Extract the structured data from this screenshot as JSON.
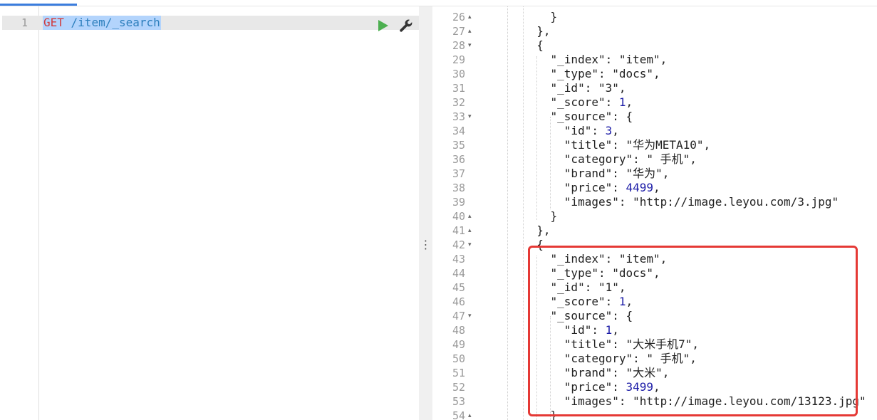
{
  "request": {
    "line_number": "1",
    "method": "GET",
    "path": " /item/_search"
  },
  "colors": {
    "highlight": "#e53935",
    "number": "#1a1aa6",
    "method": "#d03b3b",
    "path": "#2d7fbd"
  },
  "icons": {
    "run": "play-icon",
    "settings": "wrench-icon",
    "splitter": "vertical-ellipsis-icon"
  },
  "splitter": {
    "glyph": "⋮"
  },
  "response": {
    "lines": [
      {
        "n": "26",
        "fold": "▴",
        "text": "    }"
      },
      {
        "n": "27",
        "fold": "▴",
        "text": "  },"
      },
      {
        "n": "28",
        "fold": "▾",
        "text": "  {"
      },
      {
        "n": "29",
        "fold": "",
        "text": "    \"_index\": \"item\","
      },
      {
        "n": "30",
        "fold": "",
        "text": "    \"_type\": \"docs\","
      },
      {
        "n": "31",
        "fold": "",
        "text": "    \"_id\": \"3\","
      },
      {
        "n": "32",
        "fold": "",
        "text": "    \"_score\": ",
        "num": "1",
        "after": ","
      },
      {
        "n": "33",
        "fold": "▾",
        "text": "    \"_source\": {"
      },
      {
        "n": "34",
        "fold": "",
        "text": "      \"id\": ",
        "num": "3",
        "after": ","
      },
      {
        "n": "35",
        "fold": "",
        "text": "      \"title\": \"华为META10\","
      },
      {
        "n": "36",
        "fold": "",
        "text": "      \"category\": \" 手机\","
      },
      {
        "n": "37",
        "fold": "",
        "text": "      \"brand\": \"华为\","
      },
      {
        "n": "38",
        "fold": "",
        "text": "      \"price\": ",
        "num": "4499",
        "after": ","
      },
      {
        "n": "39",
        "fold": "",
        "text": "      \"images\": \"http://image.leyou.com/3.jpg\""
      },
      {
        "n": "40",
        "fold": "▴",
        "text": "    }"
      },
      {
        "n": "41",
        "fold": "▴",
        "text": "  },"
      },
      {
        "n": "42",
        "fold": "▾",
        "text": "  {"
      },
      {
        "n": "43",
        "fold": "",
        "text": "    \"_index\": \"item\","
      },
      {
        "n": "44",
        "fold": "",
        "text": "    \"_type\": \"docs\","
      },
      {
        "n": "45",
        "fold": "",
        "text": "    \"_id\": \"1\","
      },
      {
        "n": "46",
        "fold": "",
        "text": "    \"_score\": ",
        "num": "1",
        "after": ","
      },
      {
        "n": "47",
        "fold": "▾",
        "text": "    \"_source\": {"
      },
      {
        "n": "48",
        "fold": "",
        "text": "      \"id\": ",
        "num": "1",
        "after": ","
      },
      {
        "n": "49",
        "fold": "",
        "text": "      \"title\": \"大米手机7\","
      },
      {
        "n": "50",
        "fold": "",
        "text": "      \"category\": \" 手机\","
      },
      {
        "n": "51",
        "fold": "",
        "text": "      \"brand\": \"大米\","
      },
      {
        "n": "52",
        "fold": "",
        "text": "      \"price\": ",
        "num": "3499",
        "after": ","
      },
      {
        "n": "53",
        "fold": "",
        "text": "      \"images\": \"http://image.leyou.com/13123.jpg\""
      },
      {
        "n": "54",
        "fold": "▴",
        "text": "    }"
      }
    ]
  }
}
